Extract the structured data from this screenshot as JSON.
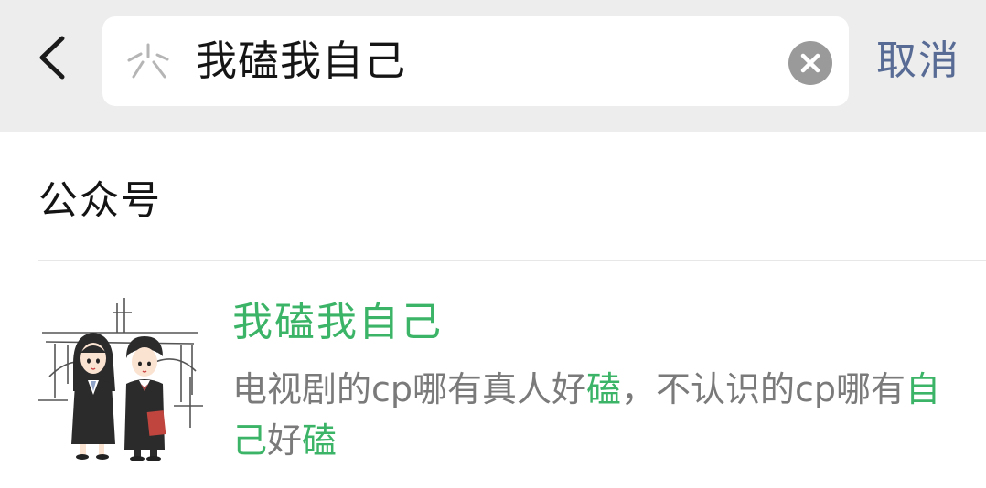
{
  "header": {
    "back_icon": "chevron-left-icon",
    "search_icon": "sparkle-search-icon",
    "query": "我磕我自己",
    "clear_icon": "clear-circle-icon",
    "cancel_label": "取消"
  },
  "section": {
    "title": "公众号"
  },
  "result": {
    "name": "我磕我自己",
    "description": {
      "part1": "电视剧的cp哪有真人好",
      "hl1": "磕",
      "part2": "，不认识的cp哪有",
      "hl2": "自己",
      "part3": "好",
      "hl3": "磕"
    },
    "avatar_icon": "cartoon-couple-avatar-icon"
  },
  "colors": {
    "header_bg": "#ededed",
    "highlight": "#3cb467",
    "cancel": "#576b95",
    "desc": "#7a7a7a",
    "clear_btn": "#9a9a9a"
  }
}
